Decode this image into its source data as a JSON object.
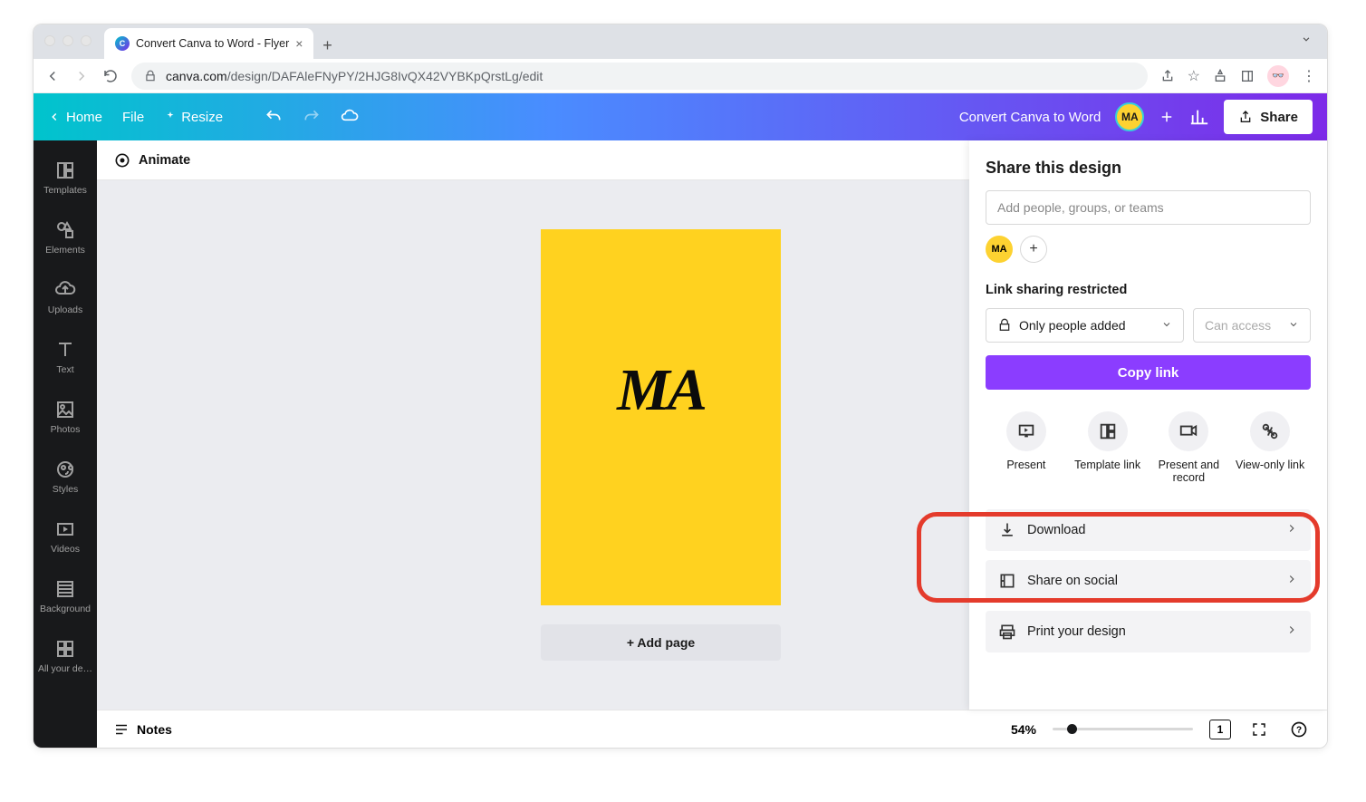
{
  "browser": {
    "tab_title": "Convert Canva to Word - Flyer",
    "url_domain": "canva.com",
    "url_path": "/design/DAFAleFNyPY/2HJG8IvQX42VYBKpQrstLg/edit"
  },
  "header": {
    "home": "Home",
    "file": "File",
    "resize": "Resize",
    "doc_name": "Convert Canva to Word",
    "avatar_initials": "MA",
    "share": "Share"
  },
  "sidebar": [
    {
      "label": "Templates",
      "name": "templates"
    },
    {
      "label": "Elements",
      "name": "elements"
    },
    {
      "label": "Uploads",
      "name": "uploads"
    },
    {
      "label": "Text",
      "name": "text"
    },
    {
      "label": "Photos",
      "name": "photos"
    },
    {
      "label": "Styles",
      "name": "styles"
    },
    {
      "label": "Videos",
      "name": "videos"
    },
    {
      "label": "Background",
      "name": "background"
    },
    {
      "label": "All your de…",
      "name": "all-your-designs"
    }
  ],
  "toolbar": {
    "animate": "Animate"
  },
  "canvas": {
    "page_text": "MA",
    "add_page": "+ Add page"
  },
  "footer": {
    "notes": "Notes",
    "zoom": "54%",
    "page_count": "1"
  },
  "share_panel": {
    "title": "Share this design",
    "people_placeholder": "Add people, groups, or teams",
    "avatar_initials": "MA",
    "link_restricted": "Link sharing restricted",
    "access_sel": "Only people added",
    "perm_sel": "Can access",
    "copy_link": "Copy link",
    "options": [
      {
        "label": "Present",
        "name": "present"
      },
      {
        "label": "Template link",
        "name": "template-link"
      },
      {
        "label": "Present and record",
        "name": "present-record"
      },
      {
        "label": "View-only link",
        "name": "view-only-link"
      }
    ],
    "actions": [
      {
        "label": "Download",
        "name": "download"
      },
      {
        "label": "Share on social",
        "name": "share-social"
      },
      {
        "label": "Print your design",
        "name": "print-design"
      }
    ]
  }
}
